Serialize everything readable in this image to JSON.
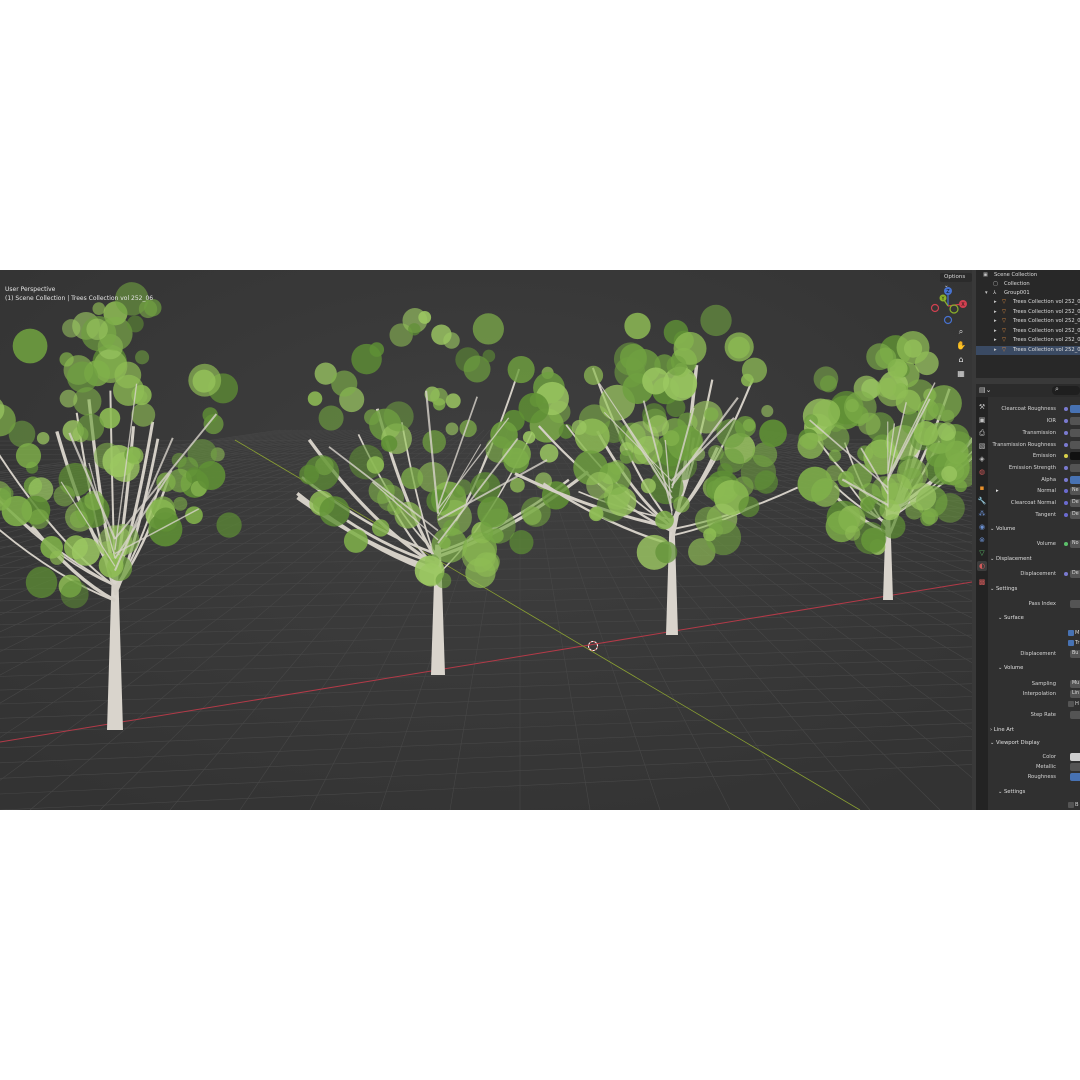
{
  "viewport": {
    "title": "User Perspective",
    "subtitle": "(1) Scene Collection | Trees Collection vol 252_06",
    "options_label": "Options",
    "gizmo_z": "Z",
    "gizmo_y": "Y",
    "gizmo_x": "X",
    "nav_icons": [
      "zoom-icon",
      "hand-pan-icon",
      "camera-icon",
      "grid-icon"
    ]
  },
  "outliner": {
    "root": "Scene Collection",
    "collection": "Collection",
    "group": "Group001",
    "items": [
      "Trees Collection vol 252_01",
      "Trees Collection vol 252_02",
      "Trees Collection vol 252_03",
      "Trees Collection vol 252_04",
      "Trees Collection vol 252_05",
      "Trees Collection vol 252_06"
    ]
  },
  "properties": {
    "rows": [
      {
        "label": "Clearcoat Roughness",
        "field": ""
      },
      {
        "label": "IOR",
        "field": ""
      },
      {
        "label": "Transmission",
        "field": ""
      },
      {
        "label": "Transmission Roughness",
        "field": ""
      },
      {
        "label": "Emission",
        "field": ""
      },
      {
        "label": "Emission Strength",
        "field": ""
      },
      {
        "label": "Alpha",
        "field": ""
      },
      {
        "label": "Normal",
        "field": "Ne"
      },
      {
        "label": "Clearcoat Normal",
        "field": "De"
      },
      {
        "label": "Tangent",
        "field": "De"
      }
    ],
    "volume_header": "Volume",
    "volume_label": "Volume",
    "volume_field": "No",
    "displacement_header": "Displacement",
    "displacement_label": "Displacement",
    "displacement_field": "De",
    "settings_header": "Settings",
    "pass_index_label": "Pass Index",
    "surface_header": "Surface",
    "surface_check1": "M",
    "surface_check2": "Tr",
    "surface_displacement_label": "Displacement",
    "surface_displacement_field": "Bu",
    "volume2_header": "Volume",
    "sampling_label": "Sampling",
    "sampling_field": "Mu",
    "interpolation_label": "Interpolation",
    "interpolation_field": "Lin",
    "hom_check": "H",
    "step_rate_label": "Step Rate",
    "line_art_header": "Line Art",
    "viewport_display_header": "Viewport Display",
    "color_label": "Color",
    "metallic_label": "Metallic",
    "roughness_label": "Roughness",
    "settings2_header": "Settings",
    "bottom_check": "B"
  },
  "colors": {
    "accent": "#4772b3",
    "x_axis": "#c83c4a",
    "y_axis": "#8ab02a",
    "foliage": "#7fb04a",
    "bark": "#d9d4cc"
  }
}
